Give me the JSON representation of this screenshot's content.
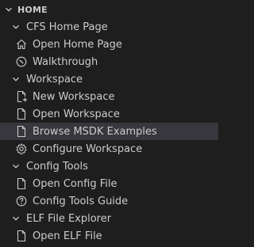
{
  "section": {
    "title": "HOME",
    "groups": [
      {
        "label": "CFS Home Page",
        "items": [
          {
            "label": "Open Home Page",
            "icon": "home-icon"
          },
          {
            "label": "Walkthrough",
            "icon": "compass-icon"
          }
        ]
      },
      {
        "label": "Workspace",
        "items": [
          {
            "label": "New Workspace",
            "icon": "new-file-icon"
          },
          {
            "label": "Open Workspace",
            "icon": "file-icon"
          },
          {
            "label": "Browse MSDK Examples",
            "icon": "file-icon",
            "selected": true
          },
          {
            "label": "Configure Workspace",
            "icon": "gear-icon"
          }
        ]
      },
      {
        "label": "Config Tools",
        "items": [
          {
            "label": "Open Config File",
            "icon": "file-icon"
          },
          {
            "label": "Config Tools Guide",
            "icon": "help-icon"
          }
        ]
      },
      {
        "label": "ELF File Explorer",
        "items": [
          {
            "label": "Open ELF File",
            "icon": "file-icon"
          }
        ]
      }
    ]
  },
  "colors": {
    "background": "#1e1e1e",
    "text": "#cccccc",
    "selected_row": "#37373d"
  }
}
